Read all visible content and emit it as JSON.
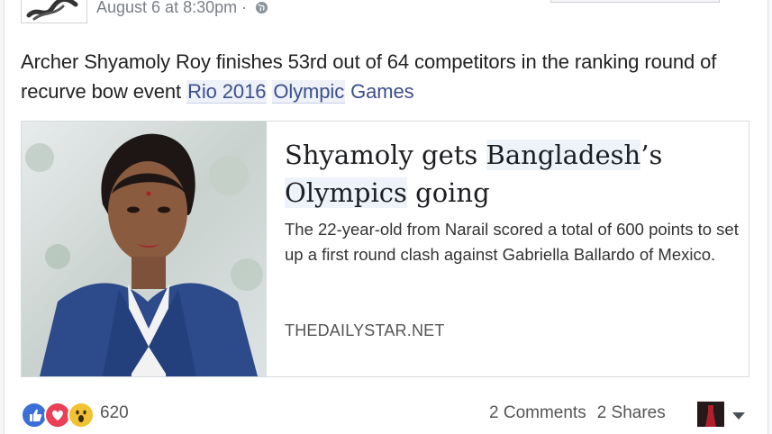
{
  "post": {
    "timestamp": "August 6 at 8:30pm",
    "separator": "·",
    "text_part1": "Archer Shyamoly Roy finishes 53rd out of 64 competitors in the ranking round of recurve bow event ",
    "link_rio": "Rio 2016",
    "link_olympic": "Olympic",
    "text_part2": " Games"
  },
  "link_card": {
    "title_part1": "Shyamoly gets ",
    "title_bangladesh": "Bangladesh",
    "title_part2": "’s ",
    "title_olympics": "Olympics",
    "title_part3": " going",
    "description": "The 22-year-old from Narail scored a total of 600 points to set up a first round clash against Gabriella Ballardo of Mexico.",
    "domain": "THEDAILYSTAR.NET"
  },
  "footer": {
    "reaction_count": "620",
    "comments": "2 Comments",
    "shares": "2 Shares"
  },
  "icons": [
    "globe-icon",
    "like-icon",
    "love-icon",
    "wow-icon",
    "chevron-down-icon"
  ],
  "colors": {
    "link": "#3b4f8c",
    "like": "#3b6fd8",
    "love": "#ea3f55",
    "wow": "#f2c233"
  }
}
